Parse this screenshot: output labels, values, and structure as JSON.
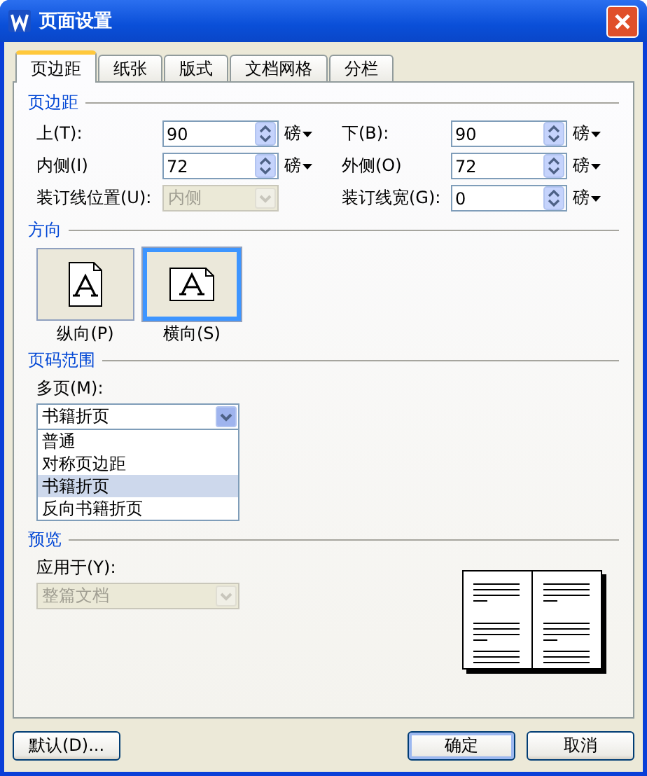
{
  "window": {
    "title": "页面设置"
  },
  "tabs": [
    {
      "label": "页边距",
      "selected": true
    },
    {
      "label": "纸张",
      "selected": false
    },
    {
      "label": "版式",
      "selected": false
    },
    {
      "label": "文档网格",
      "selected": false
    },
    {
      "label": "分栏",
      "selected": false
    }
  ],
  "margins": {
    "title": "页边距",
    "fields": [
      {
        "kind": "spin",
        "label": "上(T):",
        "value": "90",
        "unit": "磅"
      },
      {
        "kind": "spin",
        "label": "下(B):",
        "value": "90",
        "unit": "磅"
      },
      {
        "kind": "spin",
        "label": "内侧(I)",
        "value": "72",
        "unit": "磅"
      },
      {
        "kind": "spin",
        "label": "外侧(O)",
        "value": "72",
        "unit": "磅"
      },
      {
        "kind": "select",
        "label": "装订线位置(U):",
        "value": "内侧",
        "disabled": true
      },
      {
        "kind": "spin",
        "label": "装订线宽(G):",
        "value": "0",
        "unit": "磅"
      }
    ]
  },
  "orientation": {
    "title": "方向",
    "options": [
      {
        "kind": "portrait",
        "label": "纵向(P)",
        "selected": false
      },
      {
        "kind": "landscape",
        "label": "横向(S)",
        "selected": true
      }
    ]
  },
  "pages": {
    "title": "页码范围",
    "label": "多页(M):",
    "value": "书籍折页",
    "expanded": true,
    "options": [
      {
        "label": "普通",
        "selected": false
      },
      {
        "label": "对称页边距",
        "selected": false
      },
      {
        "label": "书籍折页",
        "selected": true
      },
      {
        "label": "反向书籍折页",
        "selected": false
      }
    ]
  },
  "preview": {
    "title": "预览",
    "apply_label": "应用于(Y):",
    "apply_value": "整篇文档",
    "apply_disabled": true
  },
  "buttons": [
    {
      "kind": "left",
      "label": "默认(D)...",
      "default": false
    },
    {
      "kind": "right",
      "label": "确定",
      "default": true
    },
    {
      "kind": "right",
      "label": "取消",
      "default": false
    }
  ]
}
